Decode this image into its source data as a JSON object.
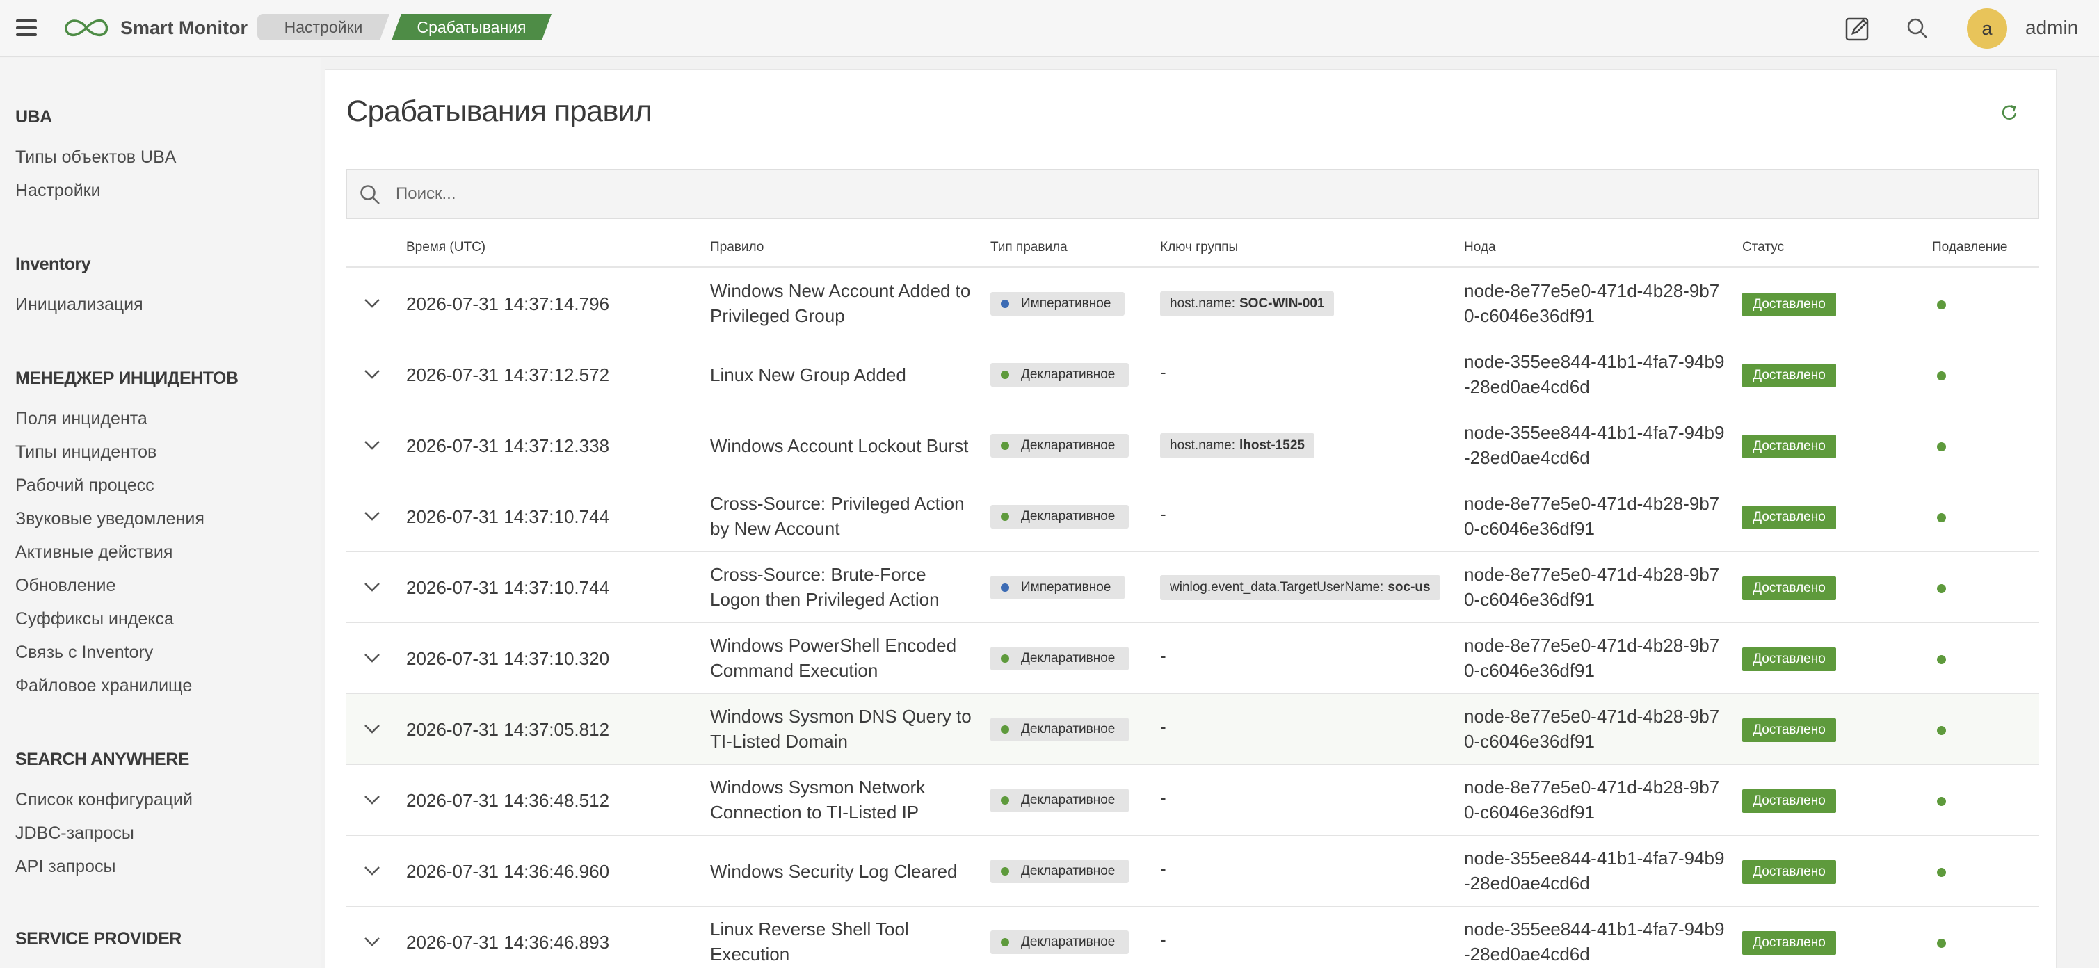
{
  "app": {
    "name": "Smart Monitor",
    "user_initial": "a",
    "user_name": "admin"
  },
  "breadcrumbs": [
    "Настройки",
    "Срабатывания"
  ],
  "colors": {
    "accent": "#4e8c46",
    "status_green": "#5e9a3c",
    "imperative_dot": "#3c6bb4",
    "declarative_dot": "#5e9a3c",
    "avatar": "#e8c45a"
  },
  "sidebar": {
    "sections": [
      {
        "title": "UBA",
        "items": [
          "Типы объектов UBA",
          "Настройки"
        ]
      },
      {
        "title": "Inventory",
        "items": [
          "Инициализация"
        ]
      },
      {
        "title": "МЕНЕДЖЕР ИНЦИДЕНТОВ",
        "items": [
          "Поля инцидента",
          "Типы инцидентов",
          "Рабочий процесс",
          "Звуковые уведомления",
          "Активные действия",
          "Обновление",
          "Суффиксы индекса",
          "Связь с Inventory",
          "Файловое хранилище"
        ]
      },
      {
        "title": "SEARCH ANYWHERE",
        "items": [
          "Список конфигураций",
          "JDBC-запросы",
          "API запросы"
        ]
      },
      {
        "title": "SERVICE PROVIDER",
        "items": []
      }
    ]
  },
  "page": {
    "title": "Срабатывания правил"
  },
  "search": {
    "placeholder": "Поиск...",
    "value": ""
  },
  "table": {
    "headers": {
      "time": "Время (UTC)",
      "rule": "Правило",
      "type": "Тип правила",
      "group": "Ключ группы",
      "node": "Нода",
      "status": "Статус",
      "suppress": "Подавление"
    },
    "rows": [
      {
        "time": "2026-07-31 14:37:14.796",
        "rule": "Windows New Account Added to Privileged Group",
        "type": "Императивное",
        "type_kind": "imperative",
        "group_key": "host.name:",
        "group_val": "SOC-WIN-001",
        "node": "node-8e77e5e0-471d-4b28-9b70-c6046e36df91",
        "status": "Доставлено"
      },
      {
        "time": "2026-07-31 14:37:12.572",
        "rule": "Linux New Group Added",
        "type": "Декларативное",
        "type_kind": "declarative",
        "group_key": "",
        "group_val": "",
        "group_dash": "-",
        "node": "node-355ee844-41b1-4fa7-94b9-28ed0ae4cd6d",
        "status": "Доставлено"
      },
      {
        "time": "2026-07-31 14:37:12.338",
        "rule": "Windows Account Lockout Burst",
        "type": "Декларативное",
        "type_kind": "declarative",
        "group_key": "host.name:",
        "group_val": "lhost-1525",
        "node": "node-355ee844-41b1-4fa7-94b9-28ed0ae4cd6d",
        "status": "Доставлено"
      },
      {
        "time": "2026-07-31 14:37:10.744",
        "rule": "Cross-Source: Privileged Action by New Account",
        "type": "Декларативное",
        "type_kind": "declarative",
        "group_key": "",
        "group_val": "",
        "group_dash": "-",
        "node": "node-8e77e5e0-471d-4b28-9b70-c6046e36df91",
        "status": "Доставлено"
      },
      {
        "time": "2026-07-31 14:37:10.744",
        "rule": "Cross-Source: Brute-Force Logon then Privileged Action",
        "type": "Императивное",
        "type_kind": "imperative",
        "group_key": "winlog.event_data.TargetUserName:",
        "group_val": "soc-us",
        "node": "node-8e77e5e0-471d-4b28-9b70-c6046e36df91",
        "status": "Доставлено"
      },
      {
        "time": "2026-07-31 14:37:10.320",
        "rule": "Windows PowerShell Encoded Command Execution",
        "type": "Декларативное",
        "type_kind": "declarative",
        "group_key": "",
        "group_val": "",
        "group_dash": "-",
        "node": "node-8e77e5e0-471d-4b28-9b70-c6046e36df91",
        "status": "Доставлено"
      },
      {
        "time": "2026-07-31 14:37:05.812",
        "rule": "Windows Sysmon DNS Query to TI-Listed Domain",
        "type": "Декларативное",
        "type_kind": "declarative",
        "group_key": "",
        "group_val": "",
        "group_dash": "-",
        "node": "node-8e77e5e0-471d-4b28-9b70-c6046e36df91",
        "status": "Доставлено",
        "highlighted": true
      },
      {
        "time": "2026-07-31 14:36:48.512",
        "rule": "Windows Sysmon Network Connection to TI-Listed IP",
        "type": "Декларативное",
        "type_kind": "declarative",
        "group_key": "",
        "group_val": "",
        "group_dash": "-",
        "node": "node-8e77e5e0-471d-4b28-9b70-c6046e36df91",
        "status": "Доставлено"
      },
      {
        "time": "2026-07-31 14:36:46.960",
        "rule": "Windows Security Log Cleared",
        "type": "Декларативное",
        "type_kind": "declarative",
        "group_key": "",
        "group_val": "",
        "group_dash": "-",
        "node": "node-355ee844-41b1-4fa7-94b9-28ed0ae4cd6d",
        "status": "Доставлено"
      },
      {
        "time": "2026-07-31 14:36:46.893",
        "rule": "Linux Reverse Shell Tool Execution",
        "type": "Декларативное",
        "type_kind": "declarative",
        "group_key": "",
        "group_val": "",
        "group_dash": "-",
        "node": "node-355ee844-41b1-4fa7-94b9-28ed0ae4cd6d",
        "status": "Доставлено"
      }
    ]
  },
  "icons": {
    "menu": "hamburger-icon",
    "logo": "infinity-logo-icon",
    "edit": "edit-icon",
    "search": "search-icon",
    "refresh": "refresh-icon",
    "expand": "chevron-down-icon",
    "suppress": "status-dot-icon"
  }
}
